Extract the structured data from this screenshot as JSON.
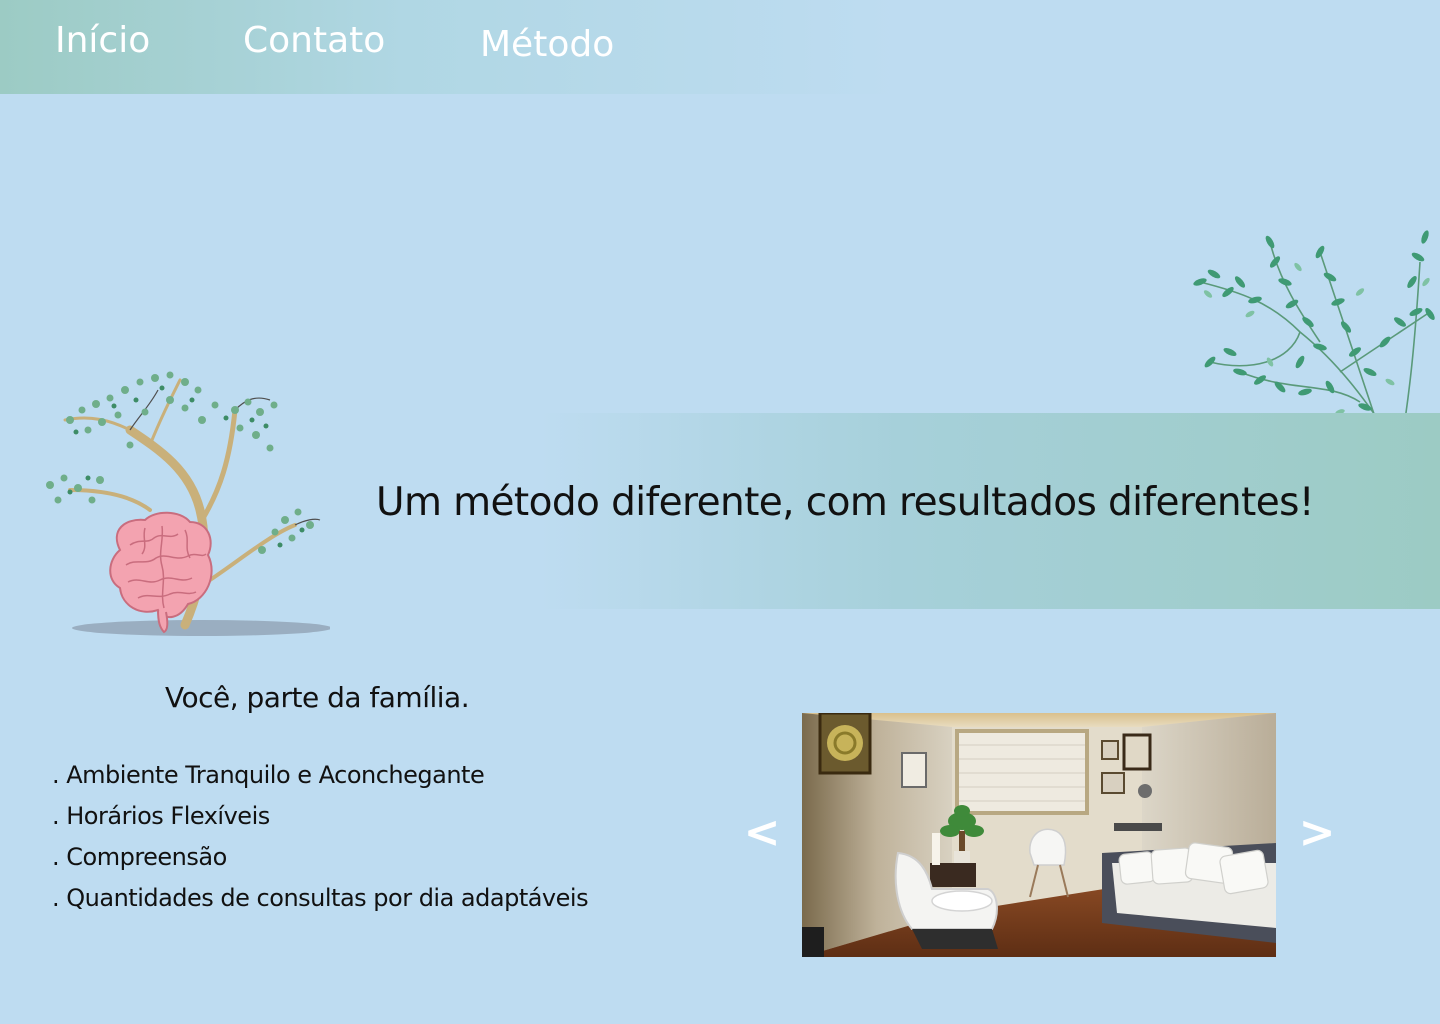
{
  "nav": {
    "items": [
      {
        "label": "Início"
      },
      {
        "label": "Contato"
      },
      {
        "label": "Método"
      }
    ]
  },
  "hero": {
    "title": "Um método diferente, com resultados diferentes!"
  },
  "section": {
    "subtitle": "Você, parte da família.",
    "features": [
      ". Ambiente Tranquilo e Aconchegante",
      ". Horários Flexíveis",
      ". Compreensão",
      ". Quantidades de consultas por dia adaptáveis"
    ]
  },
  "carousel": {
    "prev_label": "<",
    "next_label": ">"
  },
  "colors": {
    "background": "#bedcf1",
    "accent_teal": "#9ccbc4",
    "text": "#111111",
    "nav_text": "#ffffff",
    "brain_pink": "#f3a3b0",
    "leaf_green": "#3f9a74"
  },
  "icons": {
    "hero_illustration": "tree-brain-illustration",
    "decoration": "leafy-branch-illustration",
    "prev": "chevron-left-icon",
    "next": "chevron-right-icon"
  }
}
